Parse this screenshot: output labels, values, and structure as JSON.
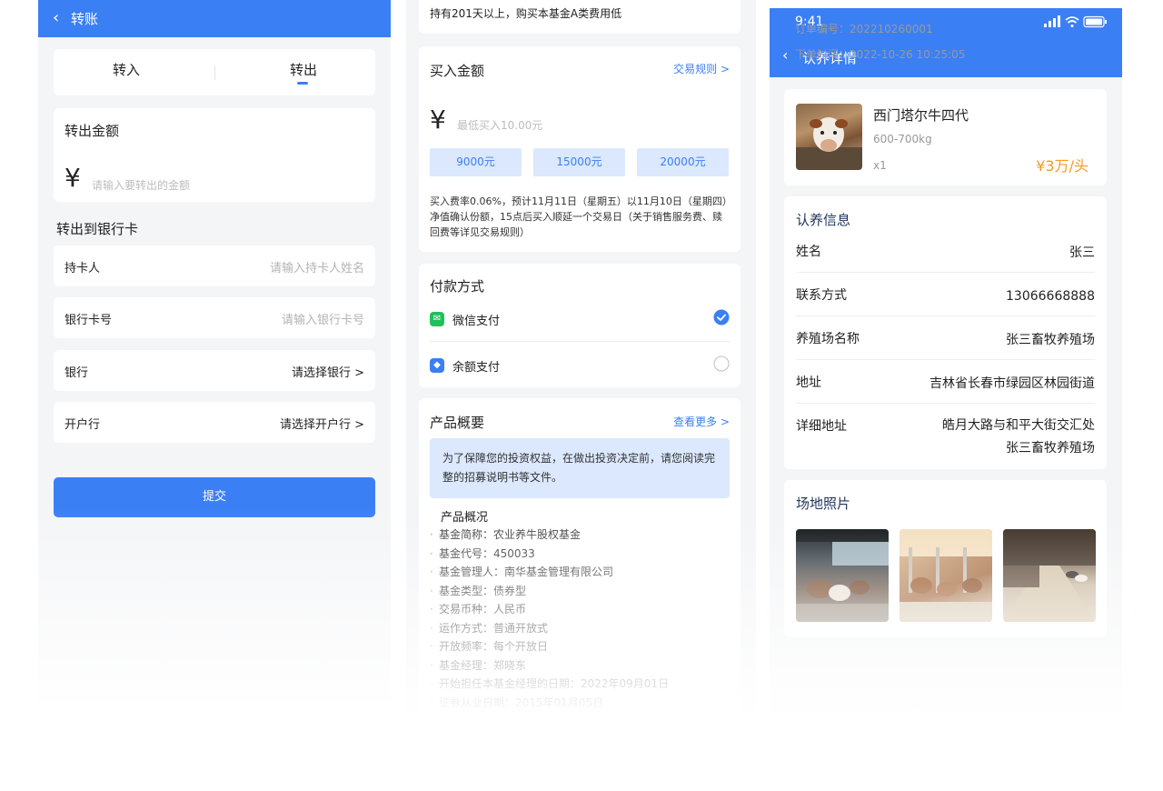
{
  "colors": {
    "primary": "#3b7ff5",
    "price": "#f39b20",
    "chip_bg": "#dbe8fd",
    "wechat": "#21c05a"
  },
  "transfer": {
    "title": "转账",
    "tabs": [
      "转入",
      "转出"
    ],
    "amount_label": "转出金额",
    "currency": "¥",
    "amount_placeholder": "请输入要转出的金额",
    "bank_section": "转出到银行卡",
    "fields": [
      {
        "label": "持卡人",
        "value": "请输入持卡人姓名"
      },
      {
        "label": "银行卡号",
        "value": "请输入银行卡号"
      },
      {
        "label": "银行",
        "value": "请选择银行 >"
      },
      {
        "label": "开户行",
        "value": "请选择开户行 >"
      }
    ],
    "submit": "提交"
  },
  "fund": {
    "top_text": "持有201天以上，购买本基金A类费用低",
    "buy_title": "买入金额",
    "rules_link": "交易规则 >",
    "currency": "¥",
    "amount_placeholder": "最低买入10.00元",
    "chips": [
      "9000元",
      "15000元",
      "20000元"
    ],
    "fee_note": "买入费率0.06%，预计11月11日（星期五）以11月10日（星期四）净值确认份额，15点后买入顺延一个交易日（关于销售服务费、赎回费等详见交易规则）",
    "pay_title": "付款方式",
    "pay_methods": [
      {
        "label": "微信支付",
        "icon": "wechat-icon",
        "selected": true
      },
      {
        "label": "余额支付",
        "icon": "wallet-icon",
        "selected": false
      }
    ],
    "summary_title": "产品概要",
    "more_link": "查看更多 >",
    "notice": "为了保障您的投资权益，在做出投资决定前，请您阅读完整的招募说明书等文件。",
    "overview_title": "产品概况",
    "overview_items": [
      "基金简称：农业养牛股权基金",
      "基金代号：450033",
      "基金管理人：南华基金管理有限公司",
      "基金类型：债券型",
      "交易币种：人民币",
      "运作方式：普通开放式",
      "开放频率：每个开放日",
      "基金经理：郑晓东",
      "开始担任本基金经理的日期：2022年09月01日",
      "证券从业日期：2015年01月05日"
    ]
  },
  "adopt": {
    "status_time": "9:41",
    "title": "认养详情",
    "product": {
      "name": "西门塔尔牛四代",
      "weight": "600-700kg",
      "qty": "x1",
      "price": "¥3万/头"
    },
    "info_title": "认养信息",
    "info": [
      {
        "label": "姓名",
        "value": "张三"
      },
      {
        "label": "联系方式",
        "value": "13066668888"
      },
      {
        "label": "养殖场名称",
        "value": "张三畜牧养殖场"
      },
      {
        "label": "地址",
        "value": "吉林省长春市绿园区林园街道"
      },
      {
        "label": "详细地址",
        "value": "皓月大路与和平大街交汇处",
        "value2": "张三畜牧养殖场"
      }
    ],
    "photos_title": "场地照片",
    "order_no": "订单编号：202210260001",
    "order_time": "下单时间：2022-10-26  10:25:05"
  }
}
